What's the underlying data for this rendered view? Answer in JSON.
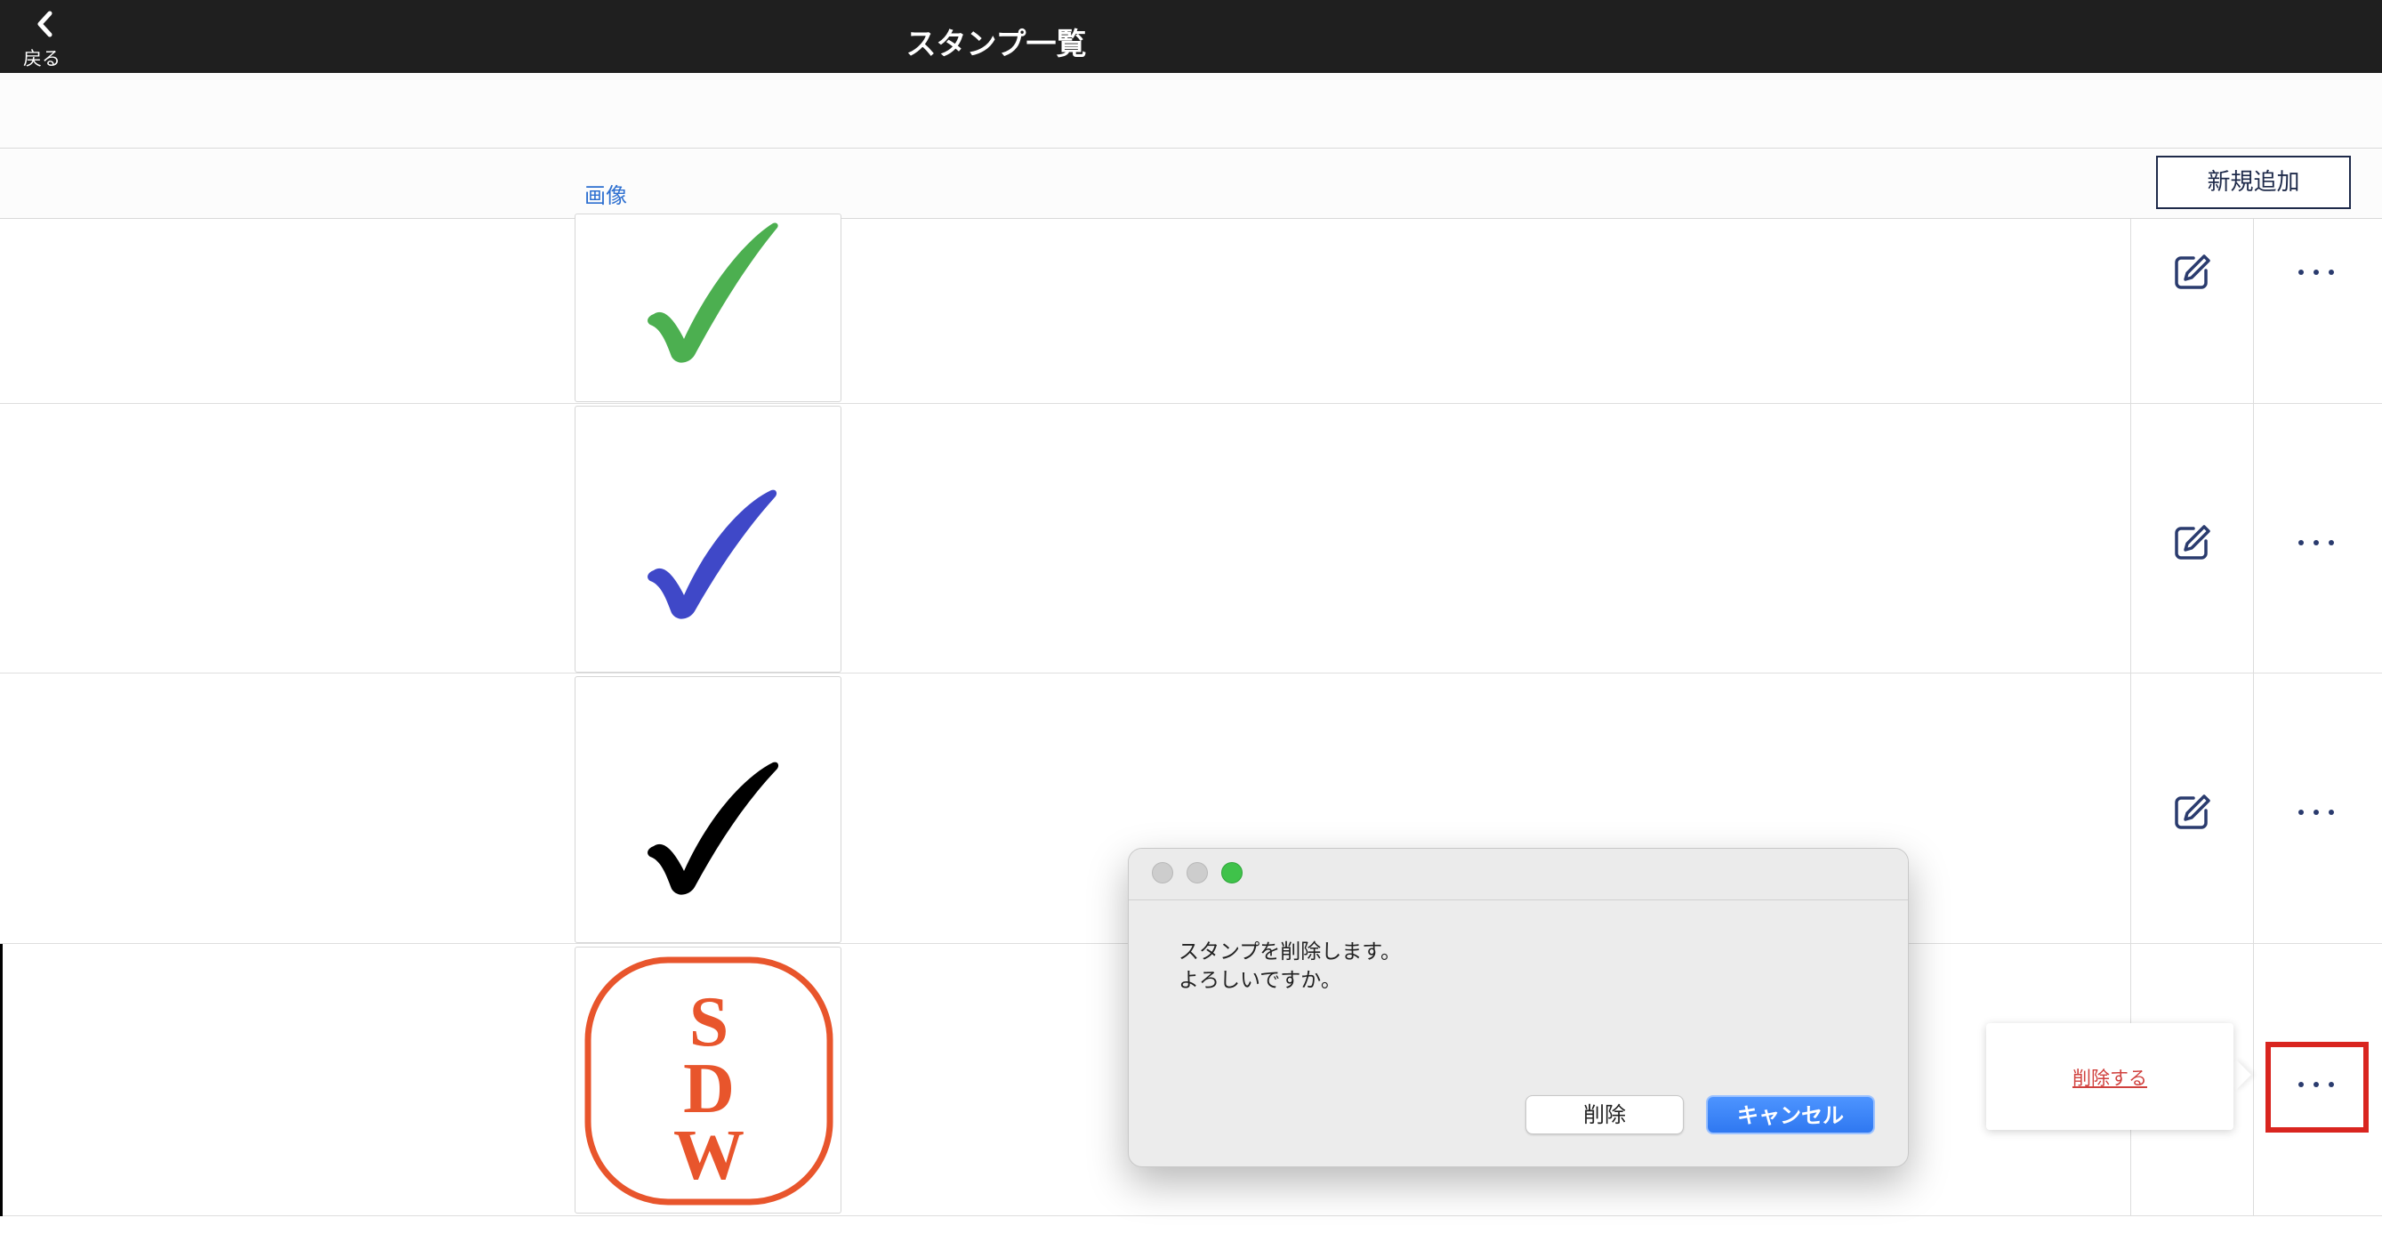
{
  "header": {
    "back_label": "戻る",
    "title": "スタンプ一覧"
  },
  "table": {
    "image_column_label": "画像",
    "add_button_label": "新規追加"
  },
  "stamps": [
    {
      "icon": "checkmark-icon",
      "color": "#4caf50"
    },
    {
      "icon": "checkmark-icon",
      "color": "#3f48c8"
    },
    {
      "icon": "checkmark-icon",
      "color": "#000000"
    },
    {
      "icon": "sdw-seal-icon",
      "color": "#e8552c",
      "text": "SDW"
    }
  ],
  "popover": {
    "delete_link": "削除する"
  },
  "dialog": {
    "message_line1": "スタンプを削除します。",
    "message_line2": "よろしいですか。",
    "delete_button": "削除",
    "cancel_button": "キャンセル"
  },
  "colors": {
    "header_bg": "#1f1f1f",
    "link": "#2d6fd0",
    "icon_navy": "#2a3b6e",
    "highlight": "#d9251f",
    "accent_blue": "#2f78f1"
  }
}
